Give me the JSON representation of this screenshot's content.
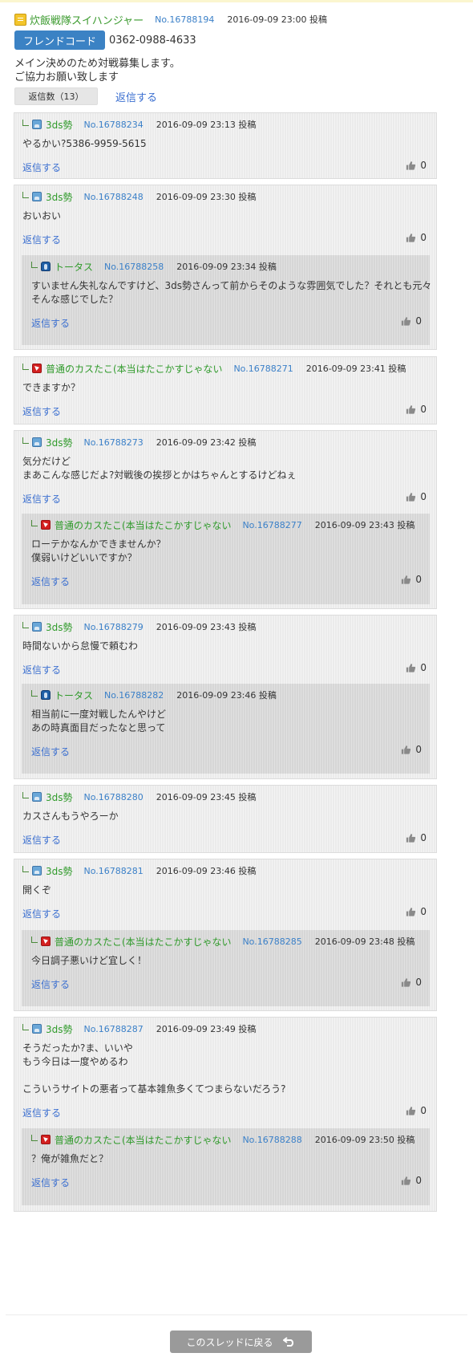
{
  "main": {
    "author": "炊飯戦隊スイハンジャー",
    "number": "No.16788194",
    "date": "2016-09-09 23:00 投稿",
    "friend_code_label": "フレンドコード",
    "friend_code": "0362-0988-4633",
    "body": [
      "メイン決めのため対戦募集します。",
      "ご協力お願い致します"
    ],
    "reply_count": "返信数（13）",
    "reply_label": "返信する"
  },
  "replies": [
    {
      "author": "3ds勢",
      "icon": "3ds-icon",
      "number": "No.16788234",
      "date": "2016-09-09 23:13 投稿",
      "body": [
        "やるかい?5386-9959-5615"
      ],
      "reply_label": "返信する",
      "likes": "0",
      "subs": []
    },
    {
      "author": "3ds勢",
      "icon": "3ds-icon",
      "number": "No.16788248",
      "date": "2016-09-09 23:30 投稿",
      "body": [
        "おいおい"
      ],
      "reply_label": "返信する",
      "likes": "0",
      "subs": [
        {
          "author": "トータス",
          "icon": "tortoise-icon",
          "number": "No.16788258",
          "date": "2016-09-09 23:34 投稿",
          "body": [
            "すいません失礼なんですけど、3ds勢さんって前からそのような雰囲気でした？それとも元々",
            "そんな感じでした？"
          ],
          "reply_label": "返信する",
          "likes": "0"
        }
      ]
    },
    {
      "author": "普通のカスたこ(本当はたこかすじゃない",
      "icon": "kasu-icon",
      "number": "No.16788271",
      "date": "2016-09-09 23:41 投稿",
      "body": [
        "できますか？"
      ],
      "reply_label": "返信する",
      "likes": "0",
      "subs": []
    },
    {
      "author": "3ds勢",
      "icon": "3ds-icon",
      "number": "No.16788273",
      "date": "2016-09-09 23:42 投稿",
      "body": [
        "気分だけど",
        "まあこんな感じだよ?対戦後の挨拶とかはちゃんとするけどねぇ"
      ],
      "reply_label": "返信する",
      "likes": "0",
      "subs": [
        {
          "author": "普通のカスたこ(本当はたこかすじゃない",
          "icon": "kasu-icon",
          "number": "No.16788277",
          "date": "2016-09-09 23:43 投稿",
          "body": [
            "ローテかなんかできませんか？",
            "僕弱いけどいいですか？"
          ],
          "reply_label": "返信する",
          "likes": "0"
        }
      ]
    },
    {
      "author": "3ds勢",
      "icon": "3ds-icon",
      "number": "No.16788279",
      "date": "2016-09-09 23:43 投稿",
      "body": [
        "時間ないから怠慢で頼むわ"
      ],
      "reply_label": "返信する",
      "likes": "0",
      "subs": [
        {
          "author": "トータス",
          "icon": "tortoise-icon",
          "number": "No.16788282",
          "date": "2016-09-09 23:46 投稿",
          "body": [
            "相当前に一度対戦したんやけど",
            "あの時真面目だったなと思って"
          ],
          "reply_label": "返信する",
          "likes": "0"
        }
      ]
    },
    {
      "author": "3ds勢",
      "icon": "3ds-icon",
      "number": "No.16788280",
      "date": "2016-09-09 23:45 投稿",
      "body": [
        "カスさんもうやろーか"
      ],
      "reply_label": "返信する",
      "likes": "0",
      "subs": []
    },
    {
      "author": "3ds勢",
      "icon": "3ds-icon",
      "number": "No.16788281",
      "date": "2016-09-09 23:46 投稿",
      "body": [
        "開くぞ"
      ],
      "reply_label": "返信する",
      "likes": "0",
      "subs": [
        {
          "author": "普通のカスたこ(本当はたこかすじゃない",
          "icon": "kasu-icon",
          "number": "No.16788285",
          "date": "2016-09-09 23:48 投稿",
          "body": [
            "今日調子悪いけど宜しく！"
          ],
          "reply_label": "返信する",
          "likes": "0"
        }
      ]
    },
    {
      "author": "3ds勢",
      "icon": "3ds-icon",
      "number": "No.16788287",
      "date": "2016-09-09 23:49 投稿",
      "body": [
        "そうだったか?ま、いいや",
        "もう今日は一度やめるわ",
        "",
        "こういうサイトの悪者って基本雑魚多くてつまらないだろう?"
      ],
      "reply_label": "返信する",
      "likes": "0",
      "subs": [
        {
          "author": "普通のカスたこ(本当はたこかすじゃない",
          "icon": "kasu-icon",
          "number": "No.16788288",
          "date": "2016-09-09 23:50 投稿",
          "body": [
            "？俺が雑魚だと？"
          ],
          "reply_label": "返信する",
          "likes": "0"
        }
      ]
    }
  ],
  "footer": {
    "back_label": "このスレッドに戻る"
  }
}
